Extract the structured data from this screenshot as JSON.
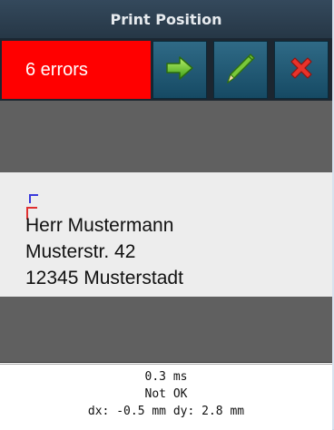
{
  "window": {
    "title": "Print Position"
  },
  "toolbar": {
    "error_text": "6 errors",
    "error_color": "#ff0000",
    "buttons": [
      {
        "name": "next",
        "icon": "arrow-right-icon"
      },
      {
        "name": "edit",
        "icon": "pencil-icon"
      },
      {
        "name": "close",
        "icon": "x-icon"
      }
    ]
  },
  "preview": {
    "address_lines": [
      "Herr Mustermann",
      "Musterstr. 42",
      "12345 Musterstadt"
    ]
  },
  "status": {
    "time": "0.3 ms",
    "result": "Not OK",
    "offset": "dx: -0.5 mm dy: 2.8 mm"
  }
}
